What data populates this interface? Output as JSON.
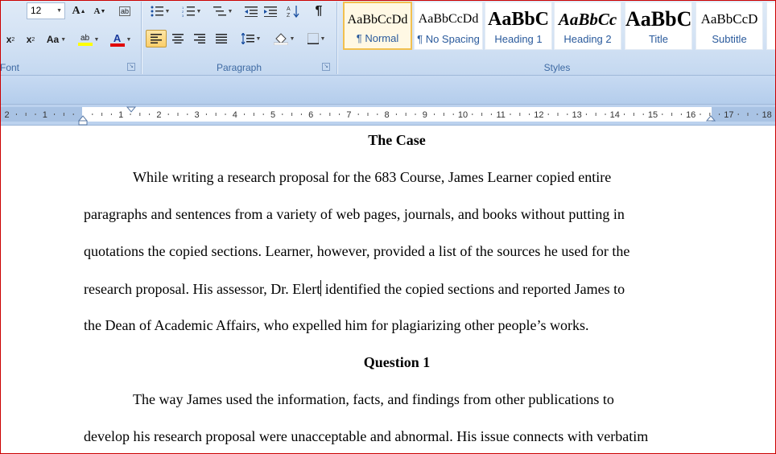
{
  "ribbon": {
    "font_group": {
      "label": "Font",
      "font_size": "12",
      "grow_font": "A",
      "shrink_font": "A",
      "clear_format": "ab",
      "subscript": "x",
      "superscript": "x",
      "change_case": "Aa",
      "highlight": "ab",
      "font_color": "A"
    },
    "paragraph_group": {
      "label": "Paragraph",
      "show_marks": "¶"
    },
    "styles_group": {
      "label": "Styles",
      "tiles": [
        {
          "preview": "AaBbCcDd",
          "name": "¶ Normal"
        },
        {
          "preview": "AaBbCcDd",
          "name": "¶ No Spacing"
        },
        {
          "preview": "AaBbC",
          "name": "Heading 1"
        },
        {
          "preview": "AaBbCc",
          "name": "Heading 2"
        },
        {
          "preview": "AaBbC",
          "name": "Title"
        },
        {
          "preview": "AaBbCcD",
          "name": "Subtitle"
        }
      ]
    },
    "accent_colors": {
      "highlight": "#ffff00",
      "font_color": "#e00000",
      "selected_tile": "#f2c04f"
    }
  },
  "ruler": {
    "left_numbers": [
      "2",
      "1"
    ],
    "numbers": [
      "1",
      "2",
      "3",
      "4",
      "5",
      "6",
      "7",
      "8",
      "9",
      "10",
      "11",
      "12",
      "13",
      "14",
      "15",
      "16",
      "17",
      "18"
    ]
  },
  "document": {
    "heading_case": "The Case",
    "para1": [
      "While writing a research proposal for the 683 Course, James Learner copied entire",
      "paragraphs and sentences from a variety of web pages, journals, and books without putting in",
      "quotations the copied sections. Learner, however, provided a list of the sources he used for the",
      "research proposal. His assessor, Dr. Elert",
      " identified the copied sections and reported James to",
      "the Dean of Academic Affairs, who expelled him for plagiarizing other people’s works."
    ],
    "heading_q1": "Question 1",
    "para2": [
      "The way James used the information, facts, and findings from other publications to",
      "develop his research proposal were unacceptable and abnormal. His issue connects with verbatim"
    ]
  }
}
